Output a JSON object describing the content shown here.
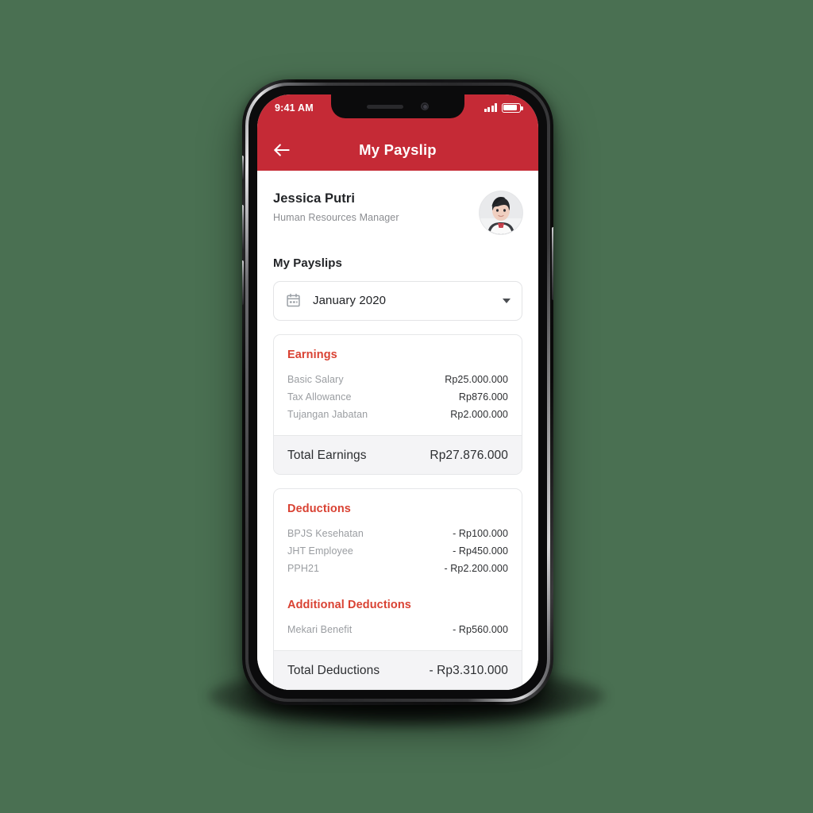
{
  "status_bar": {
    "time": "9:41 AM",
    "signal_icon": "signal-bars-icon",
    "battery_icon": "battery-icon"
  },
  "app_bar": {
    "back_icon": "back-arrow-icon",
    "title": "My Payslip"
  },
  "profile": {
    "name": "Jessica Putri",
    "role": "Human Resources Manager",
    "avatar_icon": "avatar-photo"
  },
  "payslips": {
    "section_title": "My Payslips",
    "month_selector": {
      "calendar_icon": "calendar-icon",
      "value": "January 2020",
      "caret_icon": "chevron-down-icon"
    }
  },
  "earnings_card": {
    "heading": "Earnings",
    "rows": [
      {
        "label": "Basic Salary",
        "amount": "Rp25.000.000"
      },
      {
        "label": "Tax Allowance",
        "amount": "Rp876.000"
      },
      {
        "label": "Tujangan Jabatan",
        "amount": "Rp2.000.000"
      }
    ],
    "total_label": "Total Earnings",
    "total_amount": "Rp27.876.000"
  },
  "deductions_card": {
    "heading": "Deductions",
    "rows": [
      {
        "label": "BPJS Kesehatan",
        "amount": "- Rp100.000"
      },
      {
        "label": "JHT Employee",
        "amount": "- Rp450.000"
      },
      {
        "label": "PPH21",
        "amount": "- Rp2.200.000"
      }
    ],
    "additional_heading": "Additional Deductions",
    "additional_rows": [
      {
        "label": "Mekari Benefit",
        "amount": "- Rp560.000"
      }
    ],
    "total_label": "Total Deductions",
    "total_amount": "- Rp3.310.000"
  },
  "colors": {
    "background": "#4a7052",
    "brand_red": "#c52a36",
    "accent_red": "#d94233",
    "total_row_bg": "#f4f4f6",
    "muted_text": "#9a9da1"
  }
}
